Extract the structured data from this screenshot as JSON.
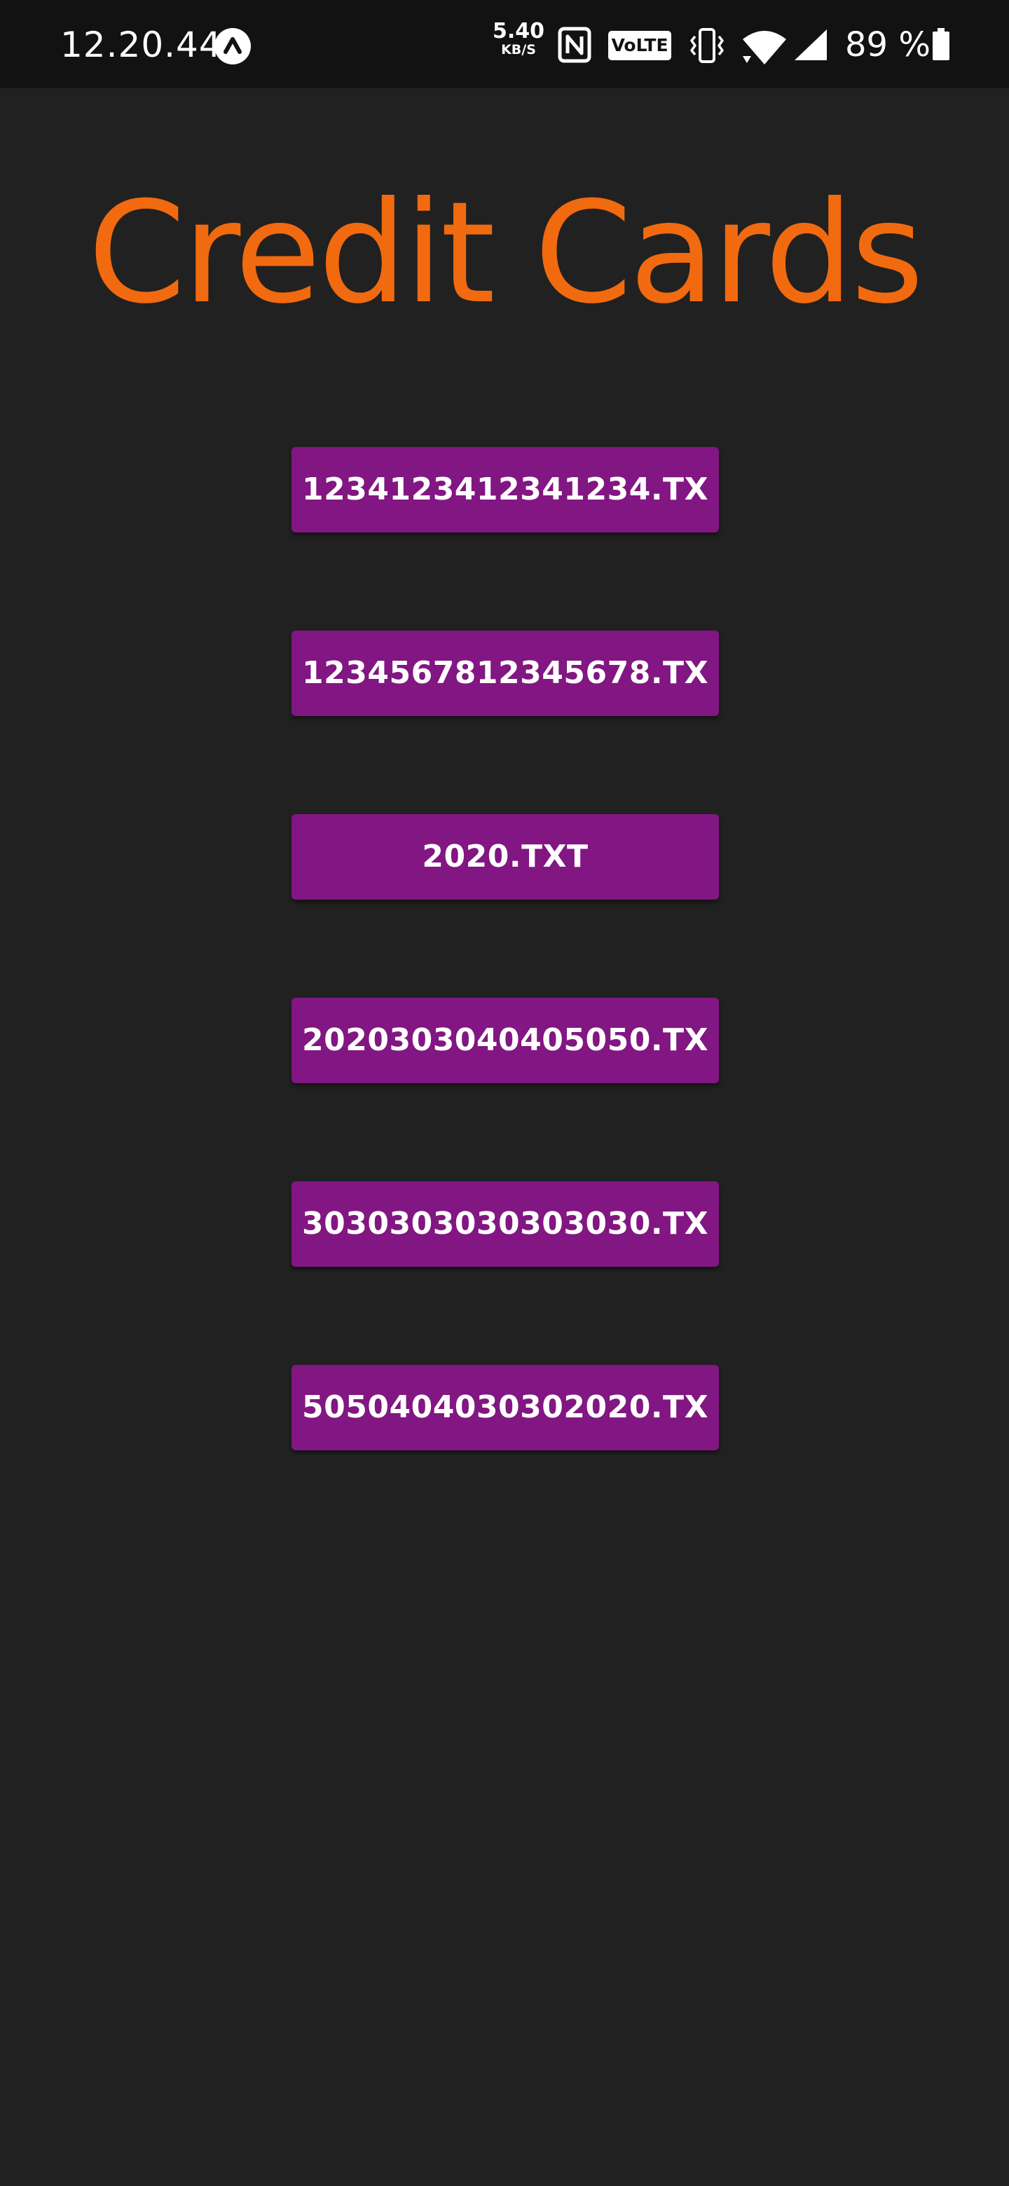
{
  "status_bar": {
    "time": "12.20.44",
    "app_icon": "arrow-up-circle-icon",
    "network_speed": "5.40",
    "network_speed_unit": "KB/S",
    "nfc_icon": "nfc-icon",
    "volte_label": "VoLTE",
    "vibrate_icon": "vibrate-icon",
    "wifi_icon": "wifi-icon",
    "signal_icon": "cell-signal-icon",
    "battery_percent": "89 %",
    "battery_icon": "battery-icon"
  },
  "page": {
    "title": "Credit Cards",
    "title_color": "#f26a0f",
    "background": "#212121"
  },
  "cards": {
    "button_color": "#821682",
    "items": [
      "1234123412341234.TX",
      "1234567812345678.TX",
      "2020.TXT",
      "2020303040405050.TX",
      "3030303030303030.TX",
      "5050404030302020.TX"
    ]
  }
}
